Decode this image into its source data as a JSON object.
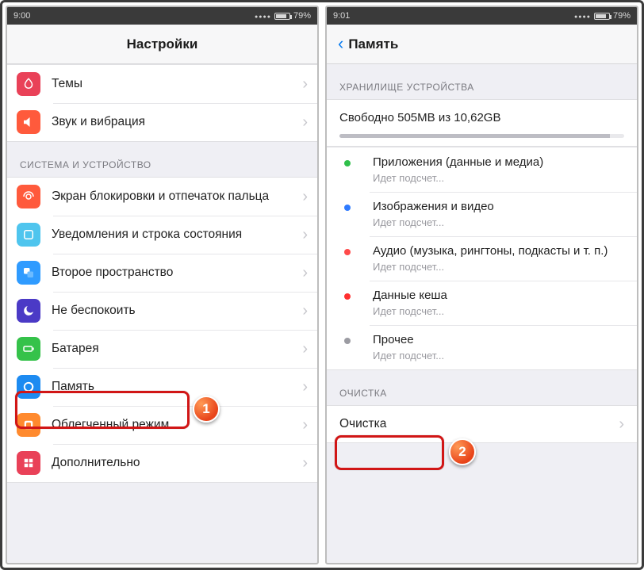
{
  "status": {
    "time_left": "9:00",
    "time_right": "9:01",
    "battery": "79%"
  },
  "left": {
    "title": "Настройки",
    "group1": [
      {
        "label": "Темы",
        "icon": "themes"
      },
      {
        "label": "Звук и вибрация",
        "icon": "sound"
      }
    ],
    "section2_header": "СИСТЕМА И УСТРОЙСТВО",
    "group2": [
      {
        "label": "Экран блокировки и отпечаток пальца",
        "icon": "lock"
      },
      {
        "label": "Уведомления и строка состояния",
        "icon": "notif"
      },
      {
        "label": "Второе пространство",
        "icon": "space"
      },
      {
        "label": "Не беспокоить",
        "icon": "dnd"
      },
      {
        "label": "Батарея",
        "icon": "batt"
      },
      {
        "label": "Память",
        "icon": "mem"
      },
      {
        "label": "Облегченный режим",
        "icon": "lite"
      },
      {
        "label": "Дополнительно",
        "icon": "more"
      }
    ],
    "callout": "1"
  },
  "right": {
    "title": "Память",
    "sec1_header": "ХРАНИЛИЩЕ УСТРОЙСТВА",
    "free_text": "Свободно 505MB из 10,62GB",
    "progress_pct": 95,
    "legend": [
      {
        "color": "#2fbf4a",
        "title": "Приложения (данные и медиа)",
        "sub": "Идет подсчет..."
      },
      {
        "color": "#2f7bff",
        "title": "Изображения и видео",
        "sub": "Идет подсчет..."
      },
      {
        "color": "#ff4a4a",
        "title": "Аудио (музыка, рингтоны, подкасты и т. п.)",
        "sub": "Идет подсчет..."
      },
      {
        "color": "#ff3030",
        "title": "Данные кеша",
        "sub": "Идет подсчет..."
      },
      {
        "color": "#9b9ba2",
        "title": "Прочее",
        "sub": "Идет подсчет..."
      }
    ],
    "sec2_header": "ОЧИСТКА",
    "clean_label": "Очистка",
    "callout": "2"
  }
}
